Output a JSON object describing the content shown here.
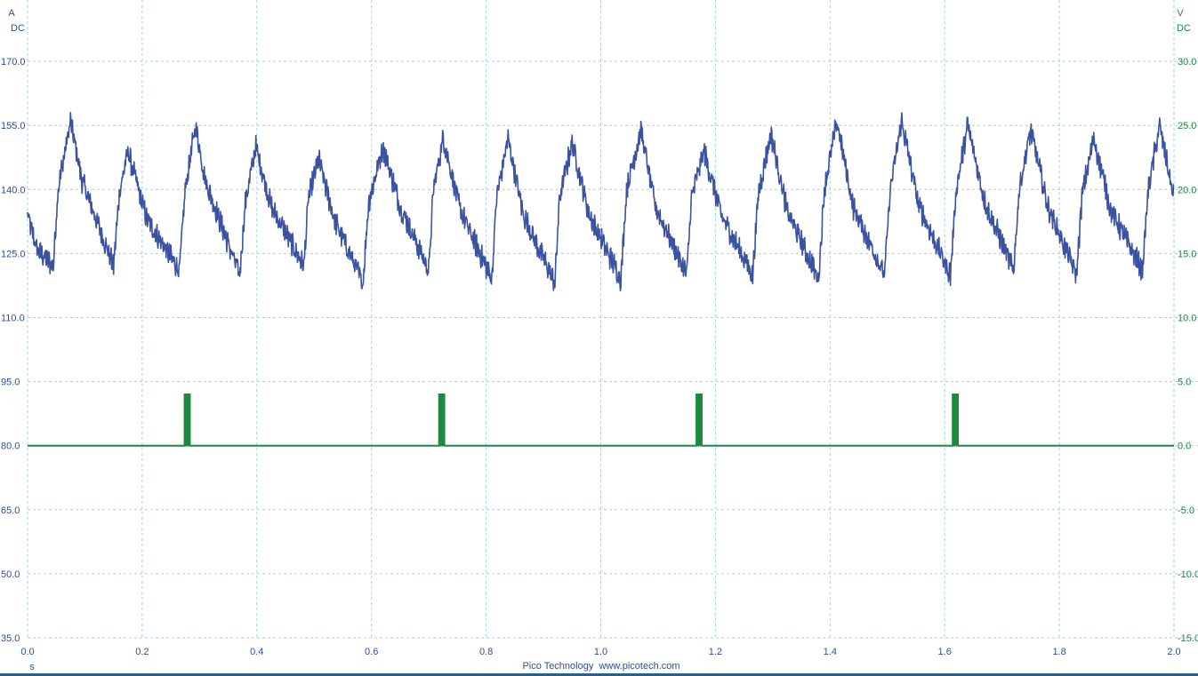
{
  "chart_data": {
    "type": "line",
    "footer": "Pico Technology  www.picotech.com",
    "x_unit": "s",
    "xlim": [
      0,
      2.0
    ],
    "x_ticks": [
      "0.0",
      "0.2",
      "0.4",
      "0.6",
      "0.8",
      "1.0",
      "1.2",
      "1.4",
      "1.6",
      "1.8",
      "2.0"
    ],
    "left_axis": {
      "unit": "A",
      "coupling": "DC",
      "color": "#2e4d9a",
      "ylim": [
        35,
        185
      ],
      "ticks": [
        "35.0",
        "50.0",
        "65.0",
        "80.0",
        "95.0",
        "110.0",
        "125.0",
        "140.0",
        "155.0",
        "170.0"
      ]
    },
    "right_axis": {
      "unit": "V",
      "coupling": "DC",
      "color": "#1a8a3e",
      "ylim": [
        -15,
        35
      ],
      "ticks": [
        "-15.0",
        "-10.0",
        "-5.0",
        "0.0",
        "5.0",
        "10.0",
        "15.0",
        "20.0",
        "25.0",
        "30.0"
      ]
    },
    "grid": true,
    "series": [
      {
        "axis": "left",
        "color": "#3a52a0",
        "baseline": 134,
        "cycle_period": 0.1125,
        "points": [
          [
            0.0,
            134
          ],
          [
            0.016,
            126
          ],
          [
            0.045,
            122
          ],
          [
            0.053,
            140
          ],
          [
            0.075,
            156
          ],
          [
            0.095,
            142
          ],
          [
            0.15,
            122
          ],
          [
            0.16,
            139
          ],
          [
            0.175,
            149
          ],
          [
            0.208,
            133
          ],
          [
            0.265,
            121
          ],
          [
            0.275,
            140
          ],
          [
            0.293,
            155
          ],
          [
            0.31,
            142
          ],
          [
            0.37,
            120
          ],
          [
            0.38,
            137
          ],
          [
            0.398,
            150
          ],
          [
            0.425,
            136
          ],
          [
            0.482,
            122
          ],
          [
            0.49,
            138
          ],
          [
            0.508,
            147
          ],
          [
            0.535,
            133
          ],
          [
            0.585,
            118
          ],
          [
            0.595,
            137
          ],
          [
            0.62,
            150
          ],
          [
            0.65,
            136
          ],
          [
            0.7,
            121
          ],
          [
            0.708,
            140
          ],
          [
            0.725,
            152
          ],
          [
            0.755,
            135
          ],
          [
            0.81,
            119
          ],
          [
            0.818,
            138
          ],
          [
            0.838,
            152
          ],
          [
            0.865,
            134
          ],
          [
            0.92,
            118
          ],
          [
            0.928,
            138
          ],
          [
            0.95,
            151
          ],
          [
            0.98,
            134
          ],
          [
            1.035,
            119
          ],
          [
            1.045,
            140
          ],
          [
            1.07,
            154
          ],
          [
            1.095,
            136
          ],
          [
            1.15,
            120
          ],
          [
            1.158,
            138
          ],
          [
            1.18,
            149
          ],
          [
            1.21,
            134
          ],
          [
            1.265,
            120
          ],
          [
            1.275,
            139
          ],
          [
            1.297,
            153
          ],
          [
            1.325,
            135
          ],
          [
            1.38,
            119
          ],
          [
            1.39,
            140
          ],
          [
            1.412,
            156
          ],
          [
            1.44,
            136
          ],
          [
            1.495,
            120
          ],
          [
            1.505,
            140
          ],
          [
            1.525,
            156
          ],
          [
            1.555,
            136
          ],
          [
            1.61,
            120
          ],
          [
            1.62,
            140
          ],
          [
            1.64,
            155
          ],
          [
            1.67,
            137
          ],
          [
            1.72,
            121
          ],
          [
            1.73,
            140
          ],
          [
            1.75,
            154
          ],
          [
            1.78,
            136
          ],
          [
            1.83,
            120
          ],
          [
            1.84,
            139
          ],
          [
            1.86,
            152
          ],
          [
            1.89,
            135
          ],
          [
            1.945,
            121
          ],
          [
            1.955,
            140
          ],
          [
            1.975,
            155
          ],
          [
            1.998,
            139
          ]
        ]
      },
      {
        "axis": "right",
        "color": "#1a8a3e",
        "baseline": 0,
        "pulses": [
          {
            "start": 0.274,
            "end": 0.283,
            "level": 4.0
          },
          {
            "start": 0.718,
            "end": 0.727,
            "level": 4.0
          },
          {
            "start": 1.167,
            "end": 1.176,
            "level": 4.0
          },
          {
            "start": 1.614,
            "end": 1.623,
            "level": 4.0
          }
        ]
      }
    ]
  }
}
